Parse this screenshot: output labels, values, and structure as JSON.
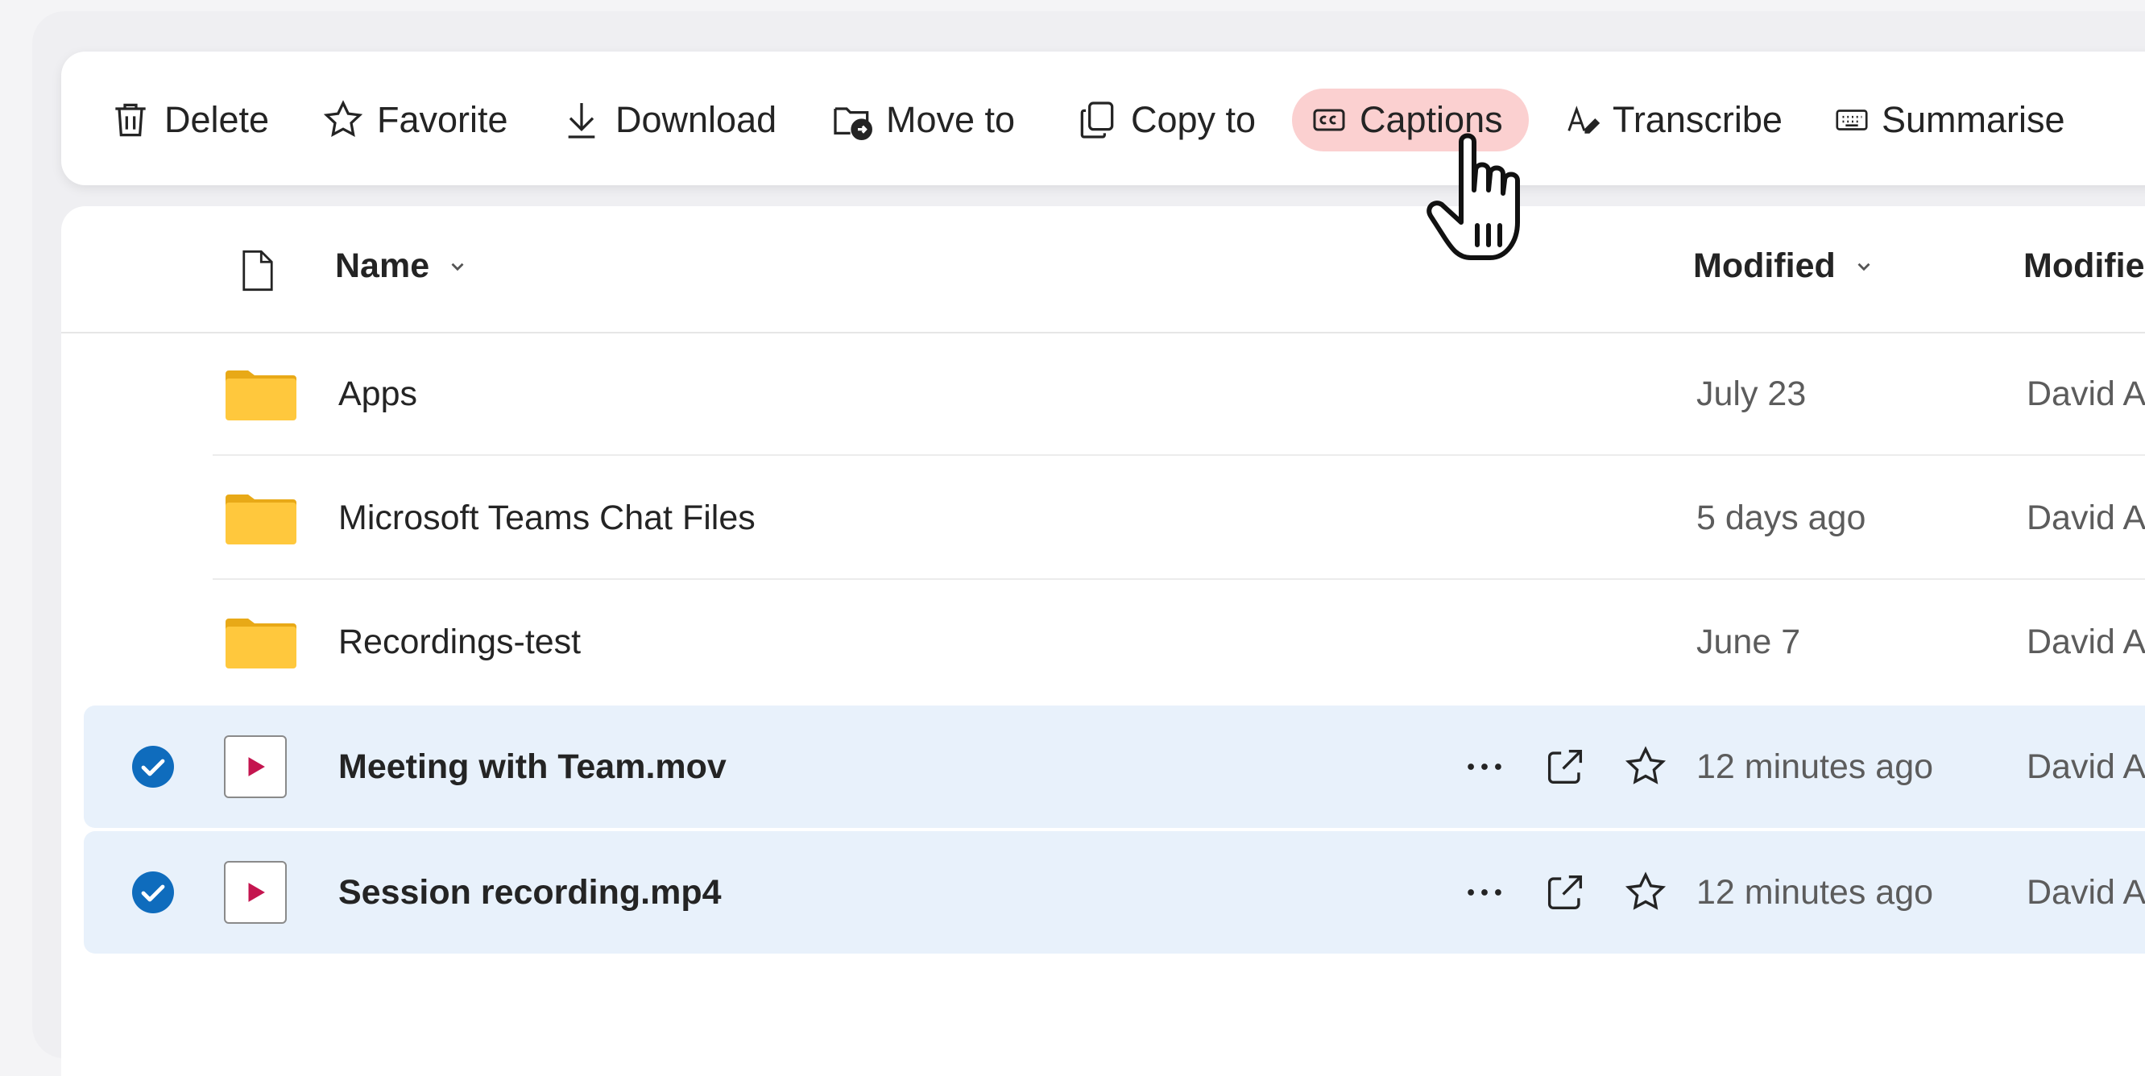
{
  "toolbar": {
    "delete_label": "Delete",
    "favorite_label": "Favorite",
    "download_label": "Download",
    "move_label": "Move to",
    "copy_label": "Copy to",
    "captions_label": "Captions",
    "transcribe_label": "Transcribe",
    "summarise_label": "Summarise"
  },
  "columns": {
    "name": "Name",
    "modified": "Modified",
    "modified_by": "Modifie"
  },
  "rows": [
    {
      "name": "Apps",
      "modified": "July 23",
      "modified_by": "David A",
      "kind": "folder",
      "selected": false
    },
    {
      "name": "Microsoft Teams Chat Files",
      "modified": "5 days ago",
      "modified_by": "David A",
      "kind": "folder",
      "selected": false
    },
    {
      "name": "Recordings-test",
      "modified": "June 7",
      "modified_by": "David A",
      "kind": "folder",
      "selected": false
    },
    {
      "name": "Meeting with Team.mov",
      "modified": "12 minutes ago",
      "modified_by": "David A",
      "kind": "video",
      "selected": true
    },
    {
      "name": "Session recording.mp4",
      "modified": "12 minutes ago",
      "modified_by": "David A",
      "kind": "video",
      "selected": true
    }
  ],
  "colors": {
    "accent": "#0f6cbd",
    "captions_highlight": "#fbd0d0",
    "selected_row": "#e8f1fb",
    "video_play": "#c4154f",
    "folder": "#ffc83d"
  }
}
